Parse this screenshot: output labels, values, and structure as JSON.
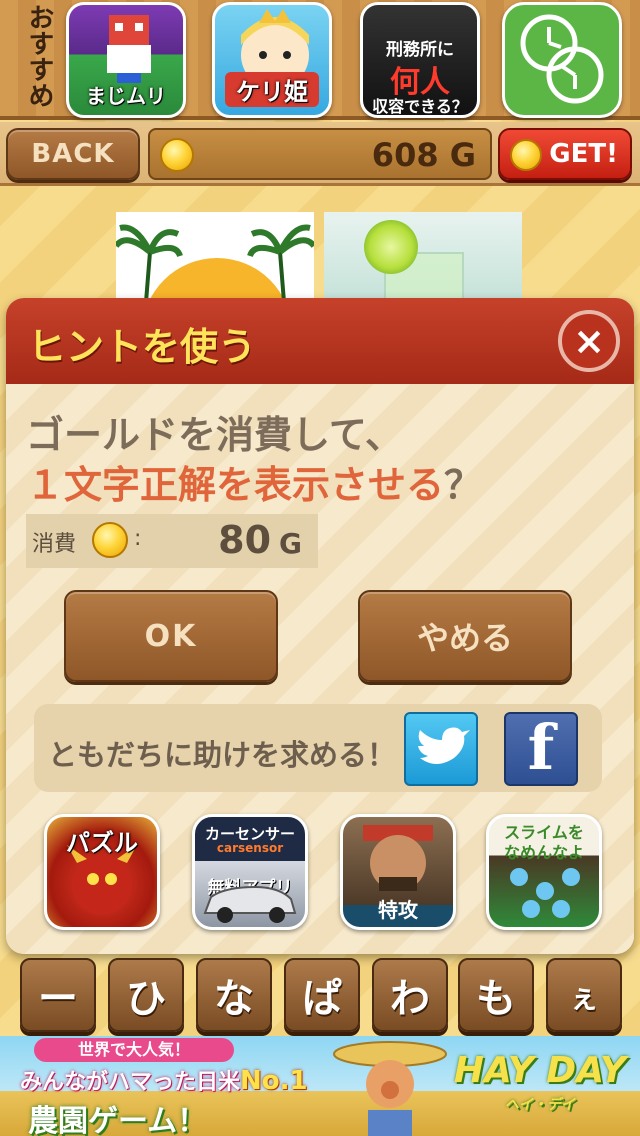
{
  "promo": {
    "label": "おすすめ",
    "tiles": [
      {
        "caption": "まじムリ"
      },
      {
        "caption": "ケリ姫"
      },
      {
        "line1": "刑務所に",
        "line2": "何人",
        "line3": "収容できる？"
      },
      {
        "caption": ""
      }
    ]
  },
  "status": {
    "back_label": "BACK",
    "gold_amount": "608 G",
    "get_label": "GET!"
  },
  "dialog": {
    "title": "ヒントを使う",
    "close_label": "×",
    "message_line1": "ゴールドを消費して、",
    "message_line2_highlight": "１文字正解を表示させる",
    "message_line2_q": "？",
    "cost_label": "消費",
    "cost_colon": ":",
    "cost_value": "80",
    "cost_unit": "G",
    "ok_label": "OK",
    "cancel_label": "やめる",
    "share_label": "ともだちに助けを求める！",
    "facebook_glyph": "f"
  },
  "apps": [
    {
      "name": "パズル"
    },
    {
      "name_top": "カーセンサー",
      "name_sub": "carsensor",
      "name_bottom": "無料アプリ"
    },
    {
      "name": "特攻"
    },
    {
      "name_line1": "スライムを",
      "name_line2": "なめんなよ"
    }
  ],
  "keys": [
    "ー",
    "ひ",
    "な",
    "ぱ",
    "わ",
    "も",
    "ぇ"
  ],
  "ad": {
    "line1": "世界で大人気！",
    "line2_a": "みんながハマった日米",
    "line2_b": "No.1",
    "line3": "農園ゲーム！",
    "brand": "HAY DAY",
    "brand_sub": "ヘイ・デイ"
  },
  "colors": {
    "header_red": "#b8321e",
    "title_yellow": "#ffe35a",
    "highlight_orange": "#e0653a",
    "gold": "#ffd53a"
  }
}
